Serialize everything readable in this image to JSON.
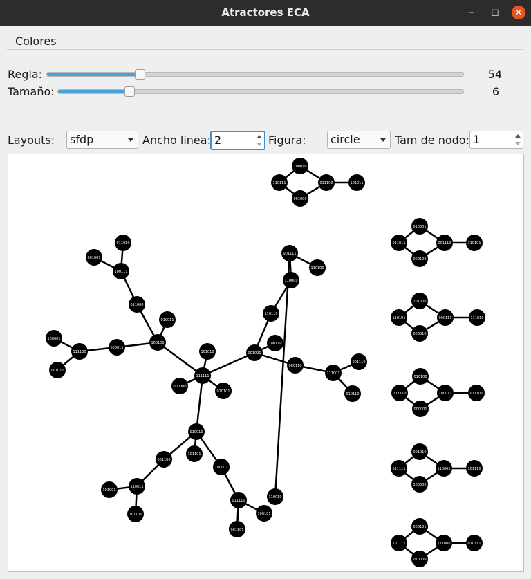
{
  "window": {
    "title": "Atractores ECA"
  },
  "menu": {
    "items": [
      "Colores"
    ]
  },
  "sliders": {
    "regla": {
      "label": "Regla:",
      "value": "54",
      "fraction": 0.222
    },
    "tamano": {
      "label": "Tamaño:",
      "value": "6",
      "fraction": 0.175
    }
  },
  "controls": {
    "layouts_label": "Layouts:",
    "layouts_value": "sfdp",
    "ancho_label": "Ancho linea:",
    "ancho_value": "2",
    "figura_label": "Figura:",
    "figura_value": "circle",
    "tam_label": "Tam de nodo:",
    "tam_value": "1"
  },
  "graph": {
    "node_color": "#000000",
    "label_color": "#ffffff",
    "nodes": [
      {
        "id": "a1",
        "label": "100010"
      },
      {
        "id": "a2",
        "label": "110111"
      },
      {
        "id": "a3",
        "label": "011100"
      },
      {
        "id": "a4",
        "label": "001000"
      },
      {
        "id": "a5",
        "label": "101011"
      },
      {
        "id": "b1",
        "label": "010001"
      },
      {
        "id": "b2",
        "label": "011011"
      },
      {
        "id": "b3",
        "label": "001110"
      },
      {
        "id": "b4",
        "label": "000100"
      },
      {
        "id": "b5",
        "label": "110101"
      },
      {
        "id": "c1",
        "label": "101000"
      },
      {
        "id": "c2",
        "label": "110101"
      },
      {
        "id": "c3",
        "label": "000111"
      },
      {
        "id": "c4",
        "label": "000010"
      },
      {
        "id": "c5",
        "label": "111010"
      },
      {
        "id": "d1",
        "label": "010100"
      },
      {
        "id": "d2",
        "label": "111110"
      },
      {
        "id": "d3",
        "label": "100011"
      },
      {
        "id": "d4",
        "label": "000001"
      },
      {
        "id": "d5",
        "label": "011101"
      },
      {
        "id": "e1",
        "label": "001010"
      },
      {
        "id": "e2",
        "label": "011111"
      },
      {
        "id": "e3",
        "label": "110001"
      },
      {
        "id": "e4",
        "label": "100000"
      },
      {
        "id": "e5",
        "label": "101110"
      },
      {
        "id": "f1",
        "label": "000101"
      },
      {
        "id": "f2",
        "label": "101111"
      },
      {
        "id": "f3",
        "label": "111000"
      },
      {
        "id": "f4",
        "label": "010000"
      },
      {
        "id": "f5",
        "label": "010111"
      },
      {
        "id": "t1",
        "label": "111111"
      },
      {
        "id": "t2",
        "label": "101010"
      },
      {
        "id": "t3",
        "label": "000000"
      },
      {
        "id": "t4",
        "label": "010101"
      },
      {
        "id": "t5",
        "label": "100100"
      },
      {
        "id": "t6",
        "label": "000011"
      },
      {
        "id": "t7",
        "label": "111100"
      },
      {
        "id": "t8",
        "label": "100001"
      },
      {
        "id": "t9",
        "label": "001011"
      },
      {
        "id": "t10",
        "label": "010011"
      },
      {
        "id": "t11",
        "label": "011000"
      },
      {
        "id": "t12",
        "label": "100111"
      },
      {
        "id": "t13",
        "label": "001001"
      },
      {
        "id": "t14",
        "label": "011010"
      },
      {
        "id": "t15",
        "label": "001001"
      },
      {
        "id": "t16",
        "label": "110110"
      },
      {
        "id": "t17",
        "label": "110000"
      },
      {
        "id": "t18",
        "label": "001111"
      },
      {
        "id": "t19",
        "label": "110100"
      },
      {
        "id": "t20",
        "label": "110010"
      },
      {
        "id": "t21",
        "label": "001110"
      },
      {
        "id": "t22",
        "label": "111001"
      },
      {
        "id": "t23",
        "label": "100110"
      },
      {
        "id": "t24",
        "label": "000110"
      },
      {
        "id": "t25",
        "label": "010010"
      },
      {
        "id": "t26",
        "label": "101101"
      },
      {
        "id": "t27",
        "label": "001100"
      },
      {
        "id": "t28",
        "label": "110011"
      },
      {
        "id": "t29",
        "label": "001101"
      },
      {
        "id": "t30",
        "label": "101100"
      },
      {
        "id": "t31",
        "label": "100001"
      },
      {
        "id": "t32",
        "label": "011110"
      },
      {
        "id": "t33",
        "label": "100101"
      },
      {
        "id": "t34",
        "label": "101001"
      },
      {
        "id": "t35",
        "label": "010110"
      }
    ],
    "edges": [
      [
        "a1",
        "a2"
      ],
      [
        "a1",
        "a3"
      ],
      [
        "a2",
        "a4"
      ],
      [
        "a4",
        "a3"
      ],
      [
        "a3",
        "a5"
      ],
      [
        "b1",
        "b2"
      ],
      [
        "b1",
        "b3"
      ],
      [
        "b2",
        "b4"
      ],
      [
        "b4",
        "b3"
      ],
      [
        "b3",
        "b5"
      ],
      [
        "c1",
        "c2"
      ],
      [
        "c1",
        "c3"
      ],
      [
        "c2",
        "c4"
      ],
      [
        "c4",
        "c3"
      ],
      [
        "c3",
        "c5"
      ],
      [
        "d1",
        "d2"
      ],
      [
        "d1",
        "d3"
      ],
      [
        "d2",
        "d4"
      ],
      [
        "d4",
        "d3"
      ],
      [
        "d3",
        "d5"
      ],
      [
        "e1",
        "e2"
      ],
      [
        "e1",
        "e3"
      ],
      [
        "e2",
        "e4"
      ],
      [
        "e4",
        "e3"
      ],
      [
        "e3",
        "e5"
      ],
      [
        "f1",
        "f2"
      ],
      [
        "f1",
        "f3"
      ],
      [
        "f2",
        "f4"
      ],
      [
        "f4",
        "f3"
      ],
      [
        "f3",
        "f5"
      ],
      [
        "t1",
        "t2"
      ],
      [
        "t1",
        "t3"
      ],
      [
        "t1",
        "t4"
      ],
      [
        "t1",
        "t5"
      ],
      [
        "t1",
        "t13"
      ],
      [
        "t1",
        "t25"
      ],
      [
        "t5",
        "t6"
      ],
      [
        "t6",
        "t7"
      ],
      [
        "t7",
        "t8"
      ],
      [
        "t7",
        "t9"
      ],
      [
        "t5",
        "t10"
      ],
      [
        "t5",
        "t11"
      ],
      [
        "t11",
        "t12"
      ],
      [
        "t12",
        "t14"
      ],
      [
        "t12",
        "t15"
      ],
      [
        "t13",
        "t23"
      ],
      [
        "t13",
        "t24"
      ],
      [
        "t13",
        "t16"
      ],
      [
        "t16",
        "t17"
      ],
      [
        "t17",
        "t18"
      ],
      [
        "t18",
        "t19"
      ],
      [
        "t18",
        "t20"
      ],
      [
        "t24",
        "t22"
      ],
      [
        "t22",
        "t21"
      ],
      [
        "t22",
        "t35"
      ],
      [
        "t25",
        "t26"
      ],
      [
        "t25",
        "t27"
      ],
      [
        "t27",
        "t28"
      ],
      [
        "t28",
        "t34"
      ],
      [
        "t28",
        "t30"
      ],
      [
        "t25",
        "t31"
      ],
      [
        "t31",
        "t32"
      ],
      [
        "t32",
        "t33"
      ],
      [
        "t32",
        "t29"
      ]
    ]
  }
}
